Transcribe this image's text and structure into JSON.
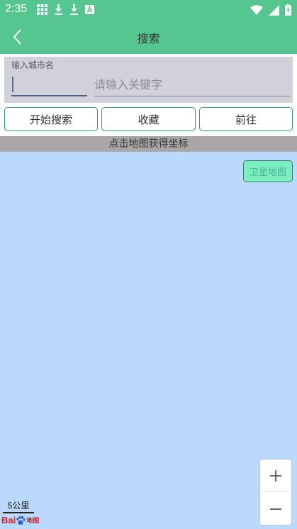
{
  "status_bar": {
    "time": "2:35"
  },
  "app_bar": {
    "title": "搜索"
  },
  "search": {
    "city_label": "输入城市名",
    "city_value": "",
    "keyword_placeholder": "请输入关键字"
  },
  "buttons": {
    "search": "开始搜索",
    "favorite": "收藏",
    "go": "前往"
  },
  "hint": "点击地图获得坐标",
  "map": {
    "satellite_label": "卫星地图",
    "scale_label": "5公里",
    "logo_text": "Bai",
    "logo_sub": "地图"
  },
  "colors": {
    "accent": "#55c690",
    "map_bg": "#bad9fc",
    "sat_btn": "#7deec0"
  }
}
